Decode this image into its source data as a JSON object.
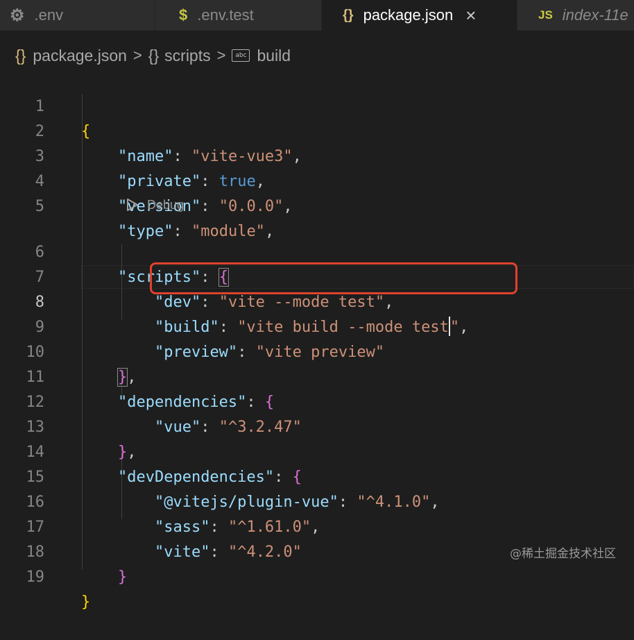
{
  "tabs": [
    {
      "label": ".env",
      "icon": "gear-icon"
    },
    {
      "label": ".env.test",
      "icon": "dollar-icon"
    },
    {
      "label": "package.json",
      "icon": "braces-icon",
      "active": true
    },
    {
      "label": "index-11e",
      "icon": "js-icon"
    }
  ],
  "tab_icons": {
    "gear": "⚙",
    "dollar": "$",
    "braces": "{}",
    "js": "JS",
    "close": "×"
  },
  "breadcrumb": {
    "file": "package.json",
    "section": "scripts",
    "item": "build",
    "braces": "{}",
    "sep": ">",
    "abc": "abc"
  },
  "codelens": {
    "label": "Debug"
  },
  "line_numbers": [
    "1",
    "2",
    "3",
    "4",
    "5",
    "6",
    "7",
    "8",
    "9",
    "10",
    "11",
    "12",
    "13",
    "14",
    "15",
    "16",
    "17",
    "18",
    "19"
  ],
  "code": {
    "l1": {
      "open": "{"
    },
    "l2": {
      "key": "\"name\"",
      "val": "\"vite-vue3\""
    },
    "l3": {
      "key": "\"private\"",
      "val": "true"
    },
    "l4": {
      "key": "\"version\"",
      "val": "\"0.0.0\""
    },
    "l5": {
      "key": "\"type\"",
      "val": "\"module\""
    },
    "l6": {
      "key": "\"scripts\"",
      "open": "{"
    },
    "l7": {
      "key": "\"dev\"",
      "val": "\"vite --mode test\""
    },
    "l8": {
      "key": "\"build\"",
      "val_a": "\"vite build --mode test",
      "val_b": "\""
    },
    "l9": {
      "key": "\"preview\"",
      "val": "\"vite preview\""
    },
    "l10": {
      "close": "}"
    },
    "l11": {
      "key": "\"dependencies\"",
      "open": "{"
    },
    "l12": {
      "key": "\"vue\"",
      "val": "\"^3.2.47\""
    },
    "l13": {
      "close": "}"
    },
    "l14": {
      "key": "\"devDependencies\"",
      "open": "{"
    },
    "l15": {
      "key": "\"@vitejs/plugin-vue\"",
      "val": "\"^4.1.0\""
    },
    "l16": {
      "key": "\"sass\"",
      "val": "\"^1.61.0\""
    },
    "l17": {
      "key": "\"vite\"",
      "val": "\"^4.2.0\""
    },
    "l18": {
      "close": "}"
    },
    "l19": {
      "close": "}"
    }
  },
  "punct": {
    "colon": ": ",
    "comma": ","
  },
  "watermark": "@稀土掘金技术社区",
  "colors": {
    "key": "#9cdcfe",
    "string": "#ce9178",
    "boolean": "#569cd6",
    "bracket_gold": "#ffd700",
    "bracket_purple": "#da70d6",
    "bracket_blue": "#179fff",
    "highlight_box": "#e0422e"
  }
}
